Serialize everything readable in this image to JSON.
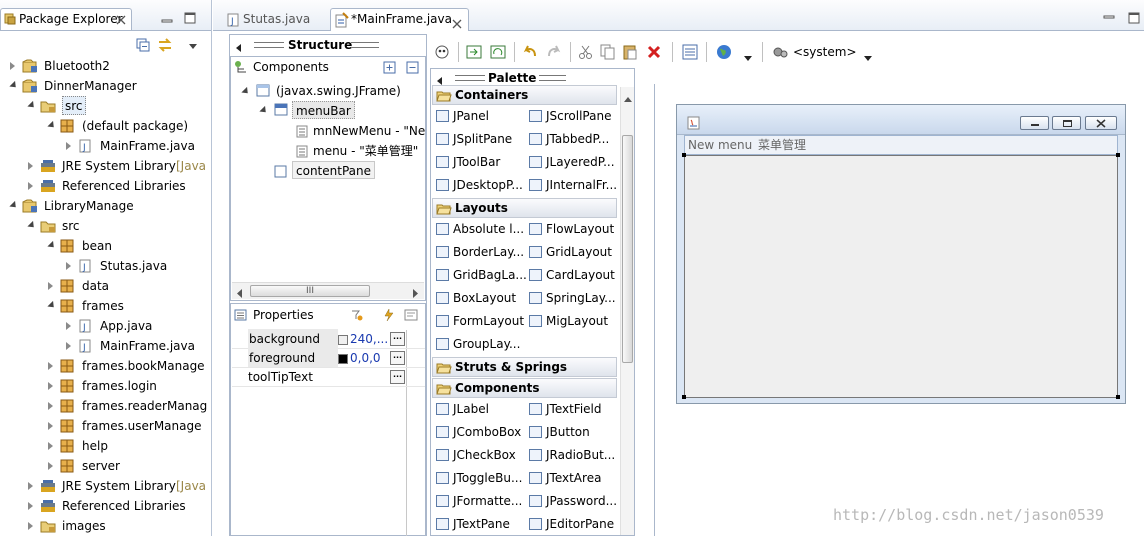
{
  "package_explorer": {
    "tab_label": "Package Explorer",
    "tree": [
      {
        "label": "Bluetooth2",
        "kind": "project"
      },
      {
        "label": "DinnerManager",
        "kind": "project"
      },
      {
        "label": "src",
        "kind": "folder"
      },
      {
        "label": "(default package)",
        "kind": "package"
      },
      {
        "label": "MainFrame.java",
        "kind": "java"
      },
      {
        "label": "JRE System Library",
        "suffix": "[Java",
        "kind": "library"
      },
      {
        "label": "Referenced Libraries",
        "kind": "library"
      },
      {
        "label": "LibraryManage",
        "kind": "project"
      },
      {
        "label": "src",
        "kind": "folder"
      },
      {
        "label": "bean",
        "kind": "package"
      },
      {
        "label": "Stutas.java",
        "kind": "java"
      },
      {
        "label": "data",
        "kind": "package"
      },
      {
        "label": "frames",
        "kind": "package"
      },
      {
        "label": "App.java",
        "kind": "java"
      },
      {
        "label": "MainFrame.java",
        "kind": "java"
      },
      {
        "label": "frames.bookManage",
        "kind": "package"
      },
      {
        "label": "frames.login",
        "kind": "package"
      },
      {
        "label": "frames.readerManag",
        "kind": "package"
      },
      {
        "label": "frames.userManage",
        "kind": "package"
      },
      {
        "label": "help",
        "kind": "package"
      },
      {
        "label": "server",
        "kind": "package"
      },
      {
        "label": "JRE System Library",
        "suffix": "[Java",
        "kind": "library"
      },
      {
        "label": "Referenced Libraries",
        "kind": "library"
      },
      {
        "label": "images",
        "kind": "folder"
      }
    ]
  },
  "editor_tabs": [
    {
      "label": "Stutas.java"
    },
    {
      "label": "*MainFrame.java"
    }
  ],
  "structure": {
    "title": "Structure",
    "components_title": "Components",
    "tree": [
      {
        "label": "(javax.swing.JFrame)"
      },
      {
        "label": "menuBar"
      },
      {
        "label": "mnNewMenu - \"Ne"
      },
      {
        "label": "menu - \"菜单管理\""
      },
      {
        "label": "contentPane"
      }
    ],
    "scroll_label": "III",
    "properties_title": "Properties",
    "properties": [
      {
        "name": "background",
        "value": "240,..."
      },
      {
        "name": "foreground",
        "value": "0,0,0"
      },
      {
        "name": "toolTipText",
        "value": ""
      }
    ],
    "ellipsis": "..."
  },
  "toolbar": {
    "system_label": "<system>"
  },
  "palette": {
    "title": "Palette",
    "sections": {
      "containers": "Containers",
      "layouts": "Layouts",
      "struts": "Struts & Springs",
      "components": "Components"
    },
    "containers": [
      "JPanel",
      "JScrollPane",
      "JSplitPane",
      "JTabbedP...",
      "JToolBar",
      "JLayeredP...",
      "JDesktopP...",
      "JInternalFr..."
    ],
    "layouts": [
      "Absolute l...",
      "FlowLayout",
      "BorderLay...",
      "GridLayout",
      "GridBagLa...",
      "CardLayout",
      "BoxLayout",
      "SpringLay...",
      "FormLayout",
      "MigLayout",
      "GroupLay..."
    ],
    "components": [
      "JLabel",
      "JTextField",
      "JComboBox",
      "JButton",
      "JCheckBox",
      "JRadioBut...",
      "JToggleBu...",
      "JTextArea",
      "JFormatte...",
      "JPassword...",
      "JTextPane",
      "JEditorPane"
    ]
  },
  "design": {
    "menu_items": [
      "New menu",
      "菜单管理"
    ]
  },
  "watermark": "http://blog.csdn.net/jason0539"
}
